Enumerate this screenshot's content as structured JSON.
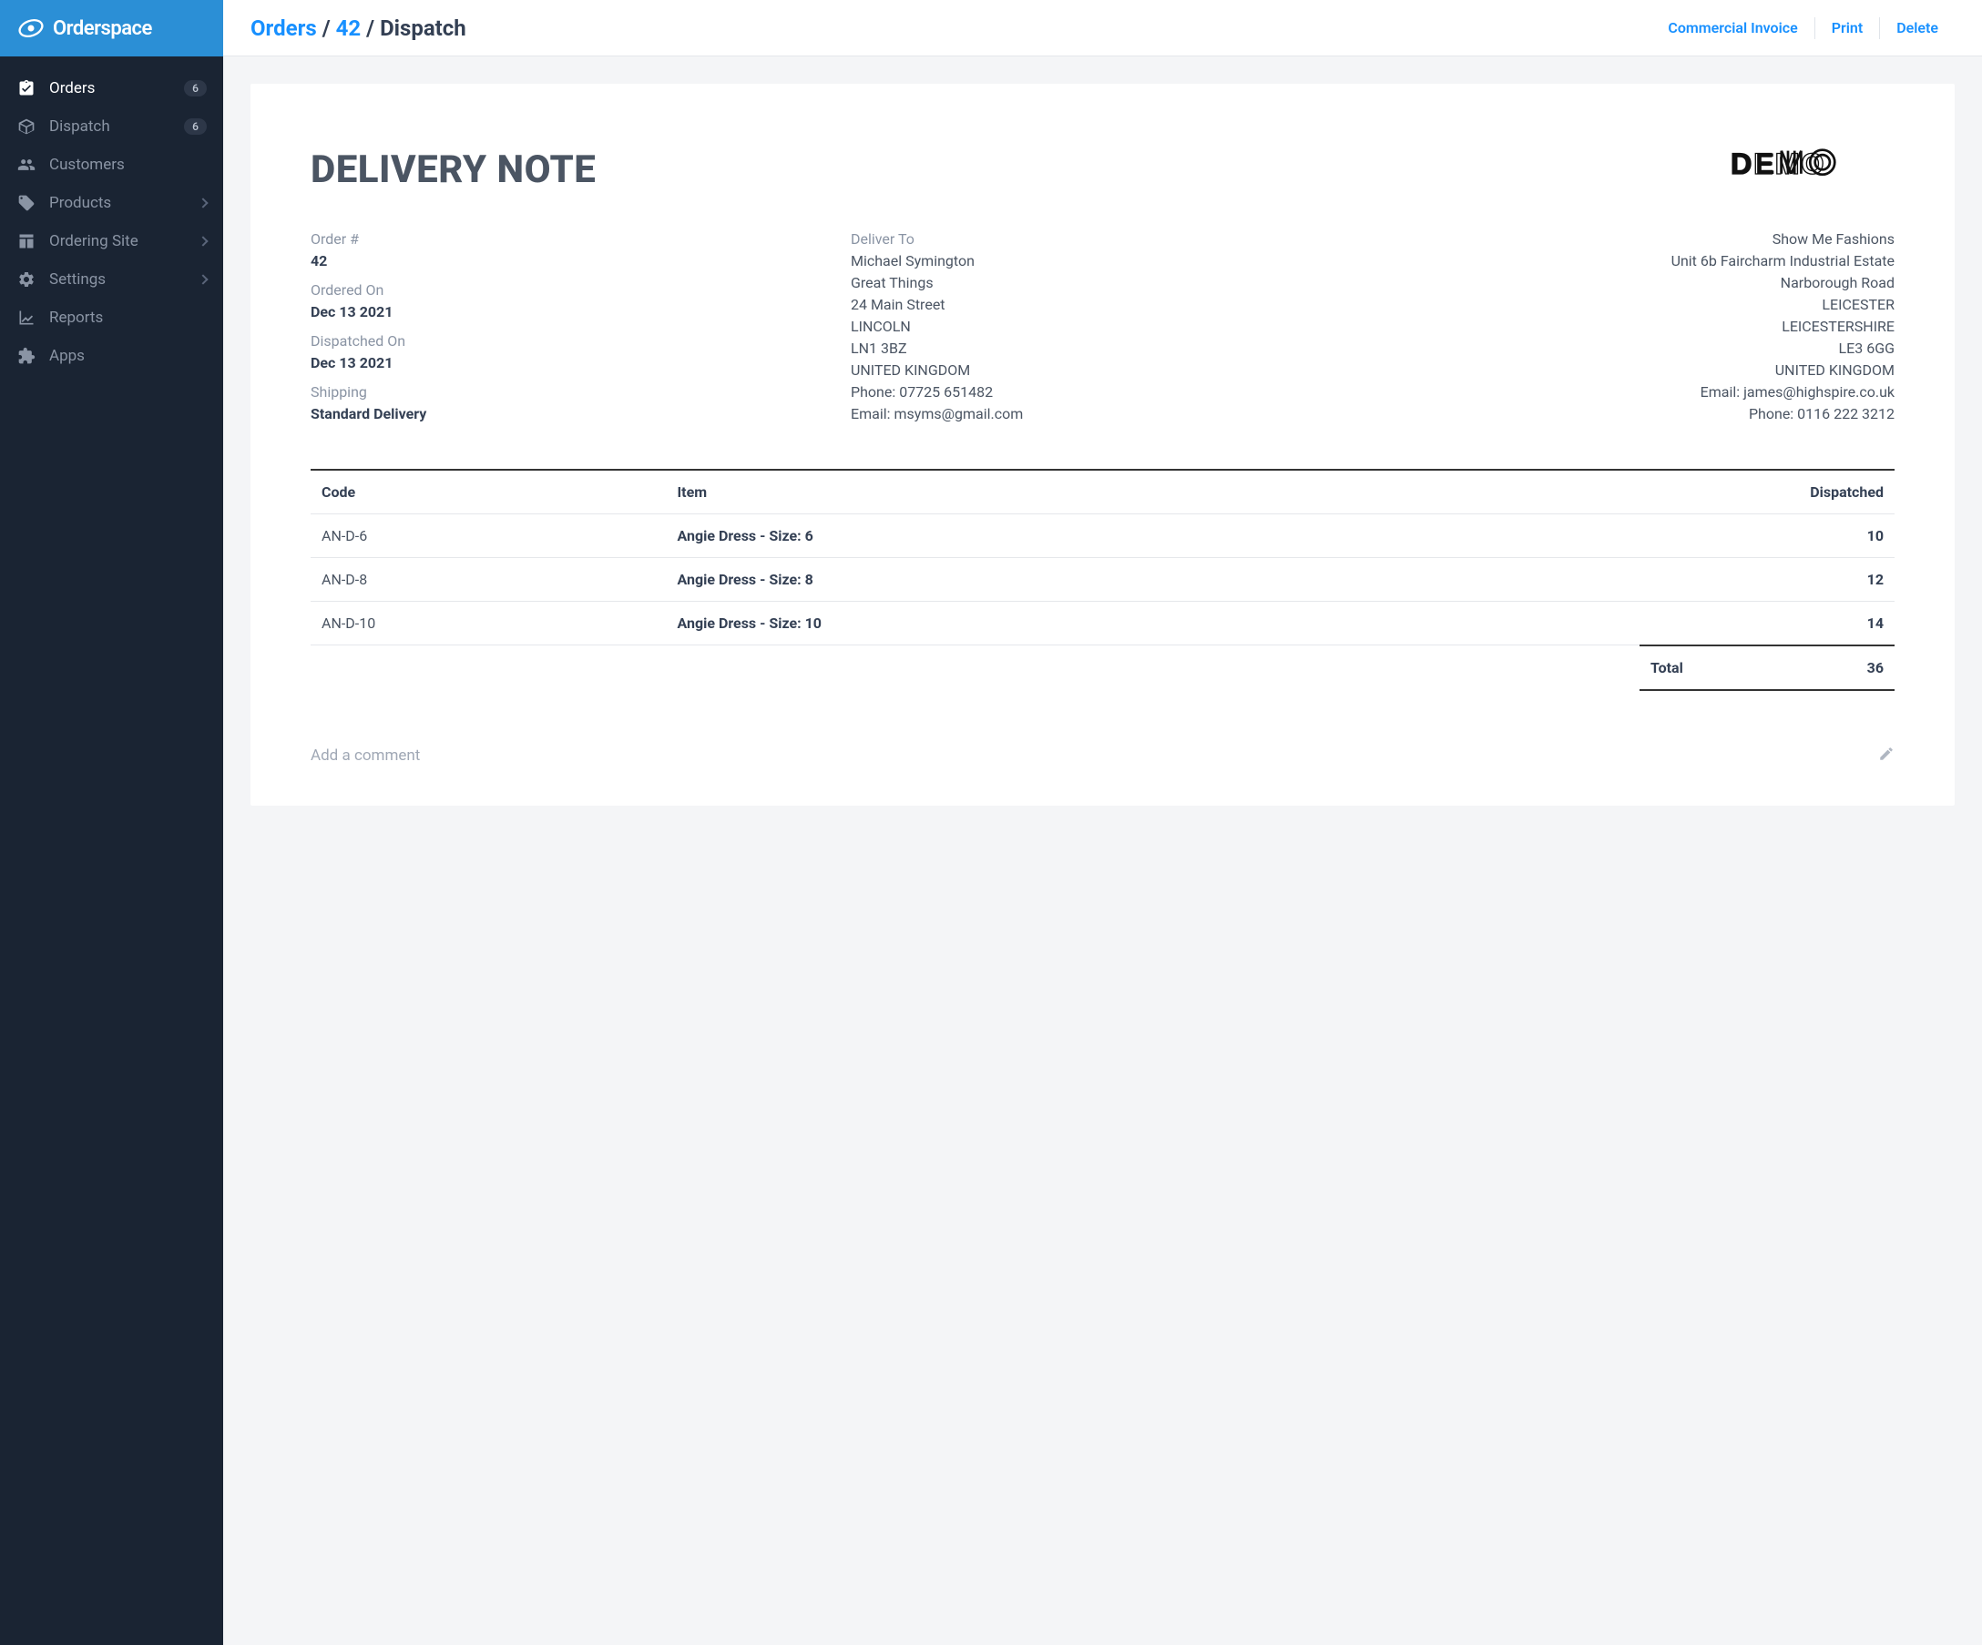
{
  "brand": "Orderspace",
  "sidebar": {
    "items": [
      {
        "label": "Orders",
        "badge": "6"
      },
      {
        "label": "Dispatch",
        "badge": "6"
      },
      {
        "label": "Customers"
      },
      {
        "label": "Products"
      },
      {
        "label": "Ordering Site"
      },
      {
        "label": "Settings"
      },
      {
        "label": "Reports"
      },
      {
        "label": "Apps"
      }
    ]
  },
  "breadcrumb": {
    "orders": "Orders",
    "order_id": "42",
    "current": "Dispatch"
  },
  "actions": {
    "commercial_invoice": "Commercial Invoice",
    "print": "Print",
    "delete": "Delete"
  },
  "document": {
    "title": "DELIVERY NOTE",
    "logo_text": "DEMO",
    "order_info": {
      "order_num_label": "Order #",
      "order_num": "42",
      "ordered_on_label": "Ordered On",
      "ordered_on": "Dec 13 2021",
      "dispatched_on_label": "Dispatched On",
      "dispatched_on": "Dec 13 2021",
      "shipping_label": "Shipping",
      "shipping": "Standard Delivery"
    },
    "deliver_to": {
      "label": "Deliver To",
      "name": "Michael Symington",
      "company": "Great Things",
      "street": "24 Main Street",
      "city": "LINCOLN",
      "postcode": "LN1 3BZ",
      "country": "UNITED KINGDOM",
      "phone": "Phone: 07725 651482",
      "email": "Email: msyms@gmail.com"
    },
    "from": {
      "company": "Show Me Fashions",
      "line1": "Unit 6b Faircharm Industrial Estate",
      "line2": "Narborough Road",
      "city": "LEICESTER",
      "region": "LEICESTERSHIRE",
      "postcode": "LE3 6GG",
      "country": "UNITED KINGDOM",
      "email": "Email: james@highspire.co.uk",
      "phone": "Phone: 0116 222 3212"
    },
    "table": {
      "headers": {
        "code": "Code",
        "item": "Item",
        "dispatched": "Dispatched"
      },
      "rows": [
        {
          "code": "AN-D-6",
          "item": "Angie Dress - Size: 6",
          "dispatched": "10"
        },
        {
          "code": "AN-D-8",
          "item": "Angie Dress - Size: 8",
          "dispatched": "12"
        },
        {
          "code": "AN-D-10",
          "item": "Angie Dress - Size: 10",
          "dispatched": "14"
        }
      ],
      "total_label": "Total",
      "total": "36"
    },
    "comment_placeholder": "Add a comment"
  }
}
